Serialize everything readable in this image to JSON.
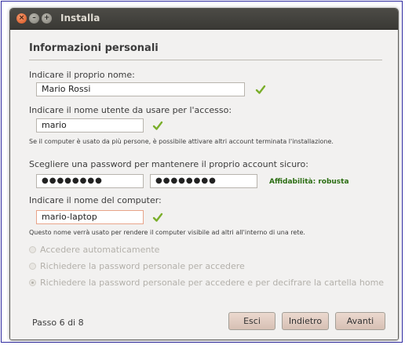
{
  "window": {
    "title": "Installa"
  },
  "section": {
    "title": "Informazioni personali"
  },
  "name": {
    "label": "Indicare il proprio nome:",
    "value": "Mario Rossi"
  },
  "username": {
    "label": "Indicare il nome utente da usare per l'accesso:",
    "value": "mario",
    "hint": "Se il computer è usato da più persone, è possibile attivare altri account terminata l'installazione."
  },
  "password": {
    "label": "Scegliere una password per mantenere il proprio account sicuro:",
    "value_masked": "●●●●●●●●",
    "confirm_masked": "●●●●●●●●",
    "strength": "Affidabilità: robusta"
  },
  "computer": {
    "label": "Indicare il nome del computer:",
    "value": "mario-laptop",
    "hint": "Questo nome verrà usato per rendere il computer visibile ad altri all'interno di una rete."
  },
  "login_options": [
    {
      "label": "Accedere automaticamente",
      "selected": false
    },
    {
      "label": "Richiedere la password personale per accedere",
      "selected": false
    },
    {
      "label": "Richiedere la password personale per accedere e per decifrare la cartella home",
      "selected": true
    }
  ],
  "footer": {
    "step": "Passo 6 di 8",
    "quit": "Esci",
    "back": "Indietro",
    "forward": "Avanti"
  },
  "colors": {
    "check_green": "#7aae2a",
    "strength_green": "#2c6e13",
    "titlebar": "#3c3b37",
    "button": "#dfc9bd"
  }
}
